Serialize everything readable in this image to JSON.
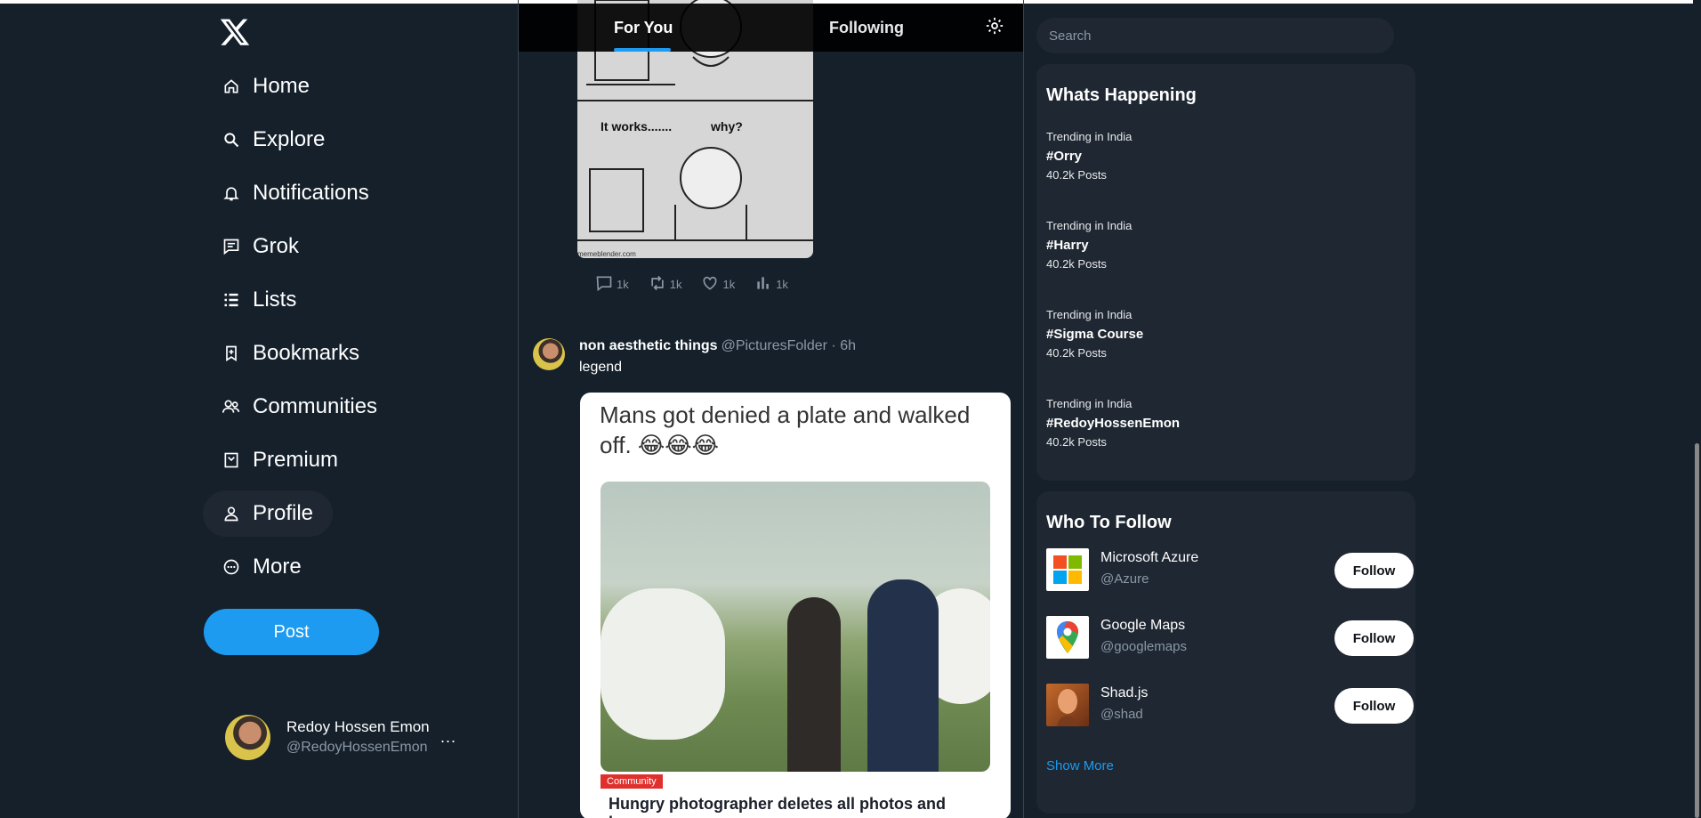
{
  "nav": {
    "logo_icon": "x-logo-icon",
    "items": [
      {
        "label": "Home",
        "icon": "home-icon"
      },
      {
        "label": "Explore",
        "icon": "search-icon"
      },
      {
        "label": "Notifications",
        "icon": "bell-icon"
      },
      {
        "label": "Grok",
        "icon": "grok-icon"
      },
      {
        "label": "Lists",
        "icon": "list-icon"
      },
      {
        "label": "Bookmarks",
        "icon": "bookmark-icon"
      },
      {
        "label": "Communities",
        "icon": "communities-icon"
      },
      {
        "label": "Premium",
        "icon": "premium-icon"
      },
      {
        "label": "Profile",
        "icon": "profile-icon",
        "active": true
      },
      {
        "label": "More",
        "icon": "more-circle-icon"
      }
    ],
    "post_label": "Post"
  },
  "account": {
    "name": "Redoy Hossen Emon",
    "handle": "@RedoyHossenEmon",
    "menu": "..."
  },
  "feed": {
    "tabs": {
      "for_you": "For You",
      "following": "Following"
    },
    "meme": {
      "caption_1": "It works.......",
      "caption_2": "why?",
      "credit": "memeblender.com"
    },
    "prev_actions": {
      "replies": "1k",
      "reposts": "1k",
      "likes": "1k",
      "views": "1k"
    },
    "tweet": {
      "name": "non aesthetic things",
      "meta": "@PicturesFolder · 6h",
      "text": "legend",
      "card_headline": "Mans got denied a plate and walked off. 😂😂😂",
      "badge": "Community",
      "news_title": "Hungry photographer deletes all photos and leaves"
    }
  },
  "sidebar": {
    "search_placeholder": "Search",
    "trends_title": "Whats Happening",
    "trends": [
      {
        "context": "Trending in India",
        "tag": "#Orry",
        "count": "40.2k Posts"
      },
      {
        "context": "Trending in India",
        "tag": "#Harry",
        "count": "40.2k Posts"
      },
      {
        "context": "Trending in India",
        "tag": "#Sigma Course",
        "count": "40.2k Posts"
      },
      {
        "context": "Trending in India",
        "tag": "#RedoyHossenEmon",
        "count": "40.2k Posts"
      }
    ],
    "follow_title": "Who To Follow",
    "follow": [
      {
        "name": "Microsoft Azure",
        "handle": "@Azure",
        "button": "Follow"
      },
      {
        "name": "Google Maps",
        "handle": "@googlemaps",
        "button": "Follow"
      },
      {
        "name": "Shad.js",
        "handle": "@shad",
        "button": "Follow"
      }
    ],
    "show_more": "Show More"
  },
  "colors": {
    "background": "#15202b",
    "accent": "#1d9bf0",
    "panel": "#1e2732"
  }
}
